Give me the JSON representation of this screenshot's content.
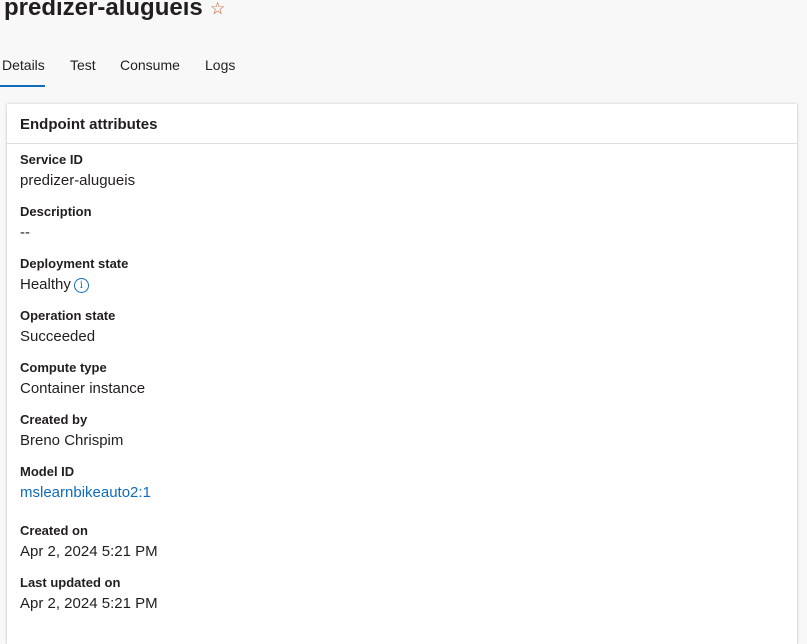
{
  "header": {
    "title": "predizer-alugueis",
    "favorite_icon": "star-outline-icon",
    "favorite_glyph": "☆"
  },
  "tabs": [
    {
      "label": "Details",
      "active": true
    },
    {
      "label": "Test",
      "active": false
    },
    {
      "label": "Consume",
      "active": false
    },
    {
      "label": "Logs",
      "active": false
    }
  ],
  "card": {
    "title": "Endpoint attributes",
    "fields": {
      "service_id": {
        "label": "Service ID",
        "value": "predizer-alugueis"
      },
      "description": {
        "label": "Description",
        "value": "--"
      },
      "deployment_state": {
        "label": "Deployment state",
        "value": "Healthy",
        "icon": "info-icon",
        "icon_glyph": "i"
      },
      "operation_state": {
        "label": "Operation state",
        "value": "Succeeded"
      },
      "compute_type": {
        "label": "Compute type",
        "value": "Container instance"
      },
      "created_by": {
        "label": "Created by",
        "value": "Breno Chrispim"
      },
      "model_id": {
        "label": "Model ID",
        "value": "mslearnbikeauto2:1"
      },
      "created_on": {
        "label": "Created on",
        "value": "Apr 2, 2024 5:21 PM"
      },
      "last_updated_on": {
        "label": "Last updated on",
        "value": "Apr 2, 2024 5:21 PM"
      }
    }
  },
  "colors": {
    "accent": "#0f6cbd",
    "favorite": "#c8541d",
    "background": "#f8f8f8",
    "card": "#ffffff"
  }
}
